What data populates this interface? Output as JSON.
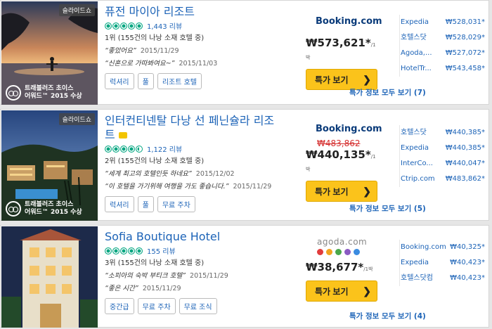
{
  "badge_label": "슬라이드쇼",
  "award_line1": "트래블러즈 초이스",
  "award_line2": "어워드™ 2015 수상",
  "per_night": "/1박",
  "deal_button": "특가 보기",
  "hotels": [
    {
      "name": "퓨전 마이아 리조트",
      "rating_bubbles": 5,
      "reviews": "1,443 리뷰",
      "rank": "1위 (155건의 나낭 소재 호텔 중)",
      "quotes": [
        {
          "text": "“좋았어요”",
          "date": "2015/11/29"
        },
        {
          "text": "“신혼으로 가따봐여요~”",
          "date": "2015/11/03"
        }
      ],
      "tags": [
        "럭셔리",
        "풀",
        "리조트 호텔"
      ],
      "provider": "Booking.com",
      "strike_price": "",
      "price": "₩573,621*",
      "all_deals": "특가 정보 모두 보기 (7)",
      "others": [
        {
          "name": "Expedia",
          "price": "₩528,031*"
        },
        {
          "name": "호텔스닷",
          "price": "₩528,029*"
        },
        {
          "name": "Agoda,...",
          "price": "₩527,072*"
        },
        {
          "name": "HotelTr...",
          "price": "₩543,458*"
        }
      ]
    },
    {
      "name": "인터컨티넨탈 다낭 선 페닌슐라 리조트",
      "rating_bubbles": 4.5,
      "reviews": "1,122 리뷰",
      "rank": "2위 (155건의 나낭 소재 호텔 중)",
      "quotes": [
        {
          "text": "“세계 최고의 호텔인듯 하네요”",
          "date": "2015/12/02"
        },
        {
          "text": "“이 호텔을 가기위해 여행을 가도 좋습니다.”",
          "date": "2015/11/29"
        }
      ],
      "tags": [
        "럭셔리",
        "풀",
        "무료 주차"
      ],
      "provider": "Booking.com",
      "strike_price": "₩483,862",
      "price": "₩440,135*",
      "all_deals": "특가 정보 모두 보기 (5)",
      "others": [
        {
          "name": "호텔스닷",
          "price": "₩440,385*"
        },
        {
          "name": "Expedia",
          "price": "₩440,385*"
        },
        {
          "name": "InterCo...",
          "price": "₩440,047*"
        },
        {
          "name": "Ctrip.com",
          "price": "₩483,862*"
        }
      ]
    },
    {
      "name": "Sofia Boutique Hotel",
      "rating_bubbles": 5,
      "reviews": "155 리뷰",
      "rank": "3위 (155건의 나낭 소재 호텔 중)",
      "quotes": [
        {
          "text": "“소피아의 숙박 부티크 호텔”",
          "date": "2015/11/29"
        },
        {
          "text": "“좋은 시간”",
          "date": "2015/11/29"
        }
      ],
      "tags": [
        "중간급",
        "무료 주차",
        "무료 조식"
      ],
      "provider": "agoda.com",
      "strike_price": "",
      "price": "₩38,677*",
      "all_deals": "특가 정보 모두 보기 (4)",
      "others": [
        {
          "name": "Booking.com",
          "price": "₩40,325*"
        },
        {
          "name": "Expedia",
          "price": "₩40,423*"
        },
        {
          "name": "호텔스닷컴",
          "price": "₩40,423*"
        }
      ]
    }
  ],
  "colors": {
    "link": "#1c63b7",
    "deal_button": "#fbc31b",
    "bubble": "#00a680",
    "strike": "#d52e2e"
  }
}
